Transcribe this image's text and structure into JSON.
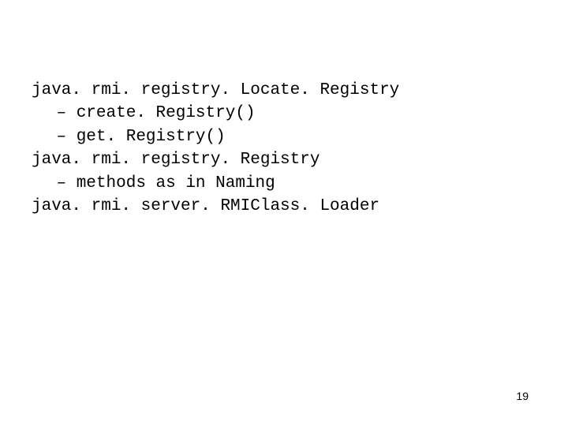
{
  "content": {
    "line1": "java. rmi. registry. Locate. Registry",
    "line2": "– create. Registry()",
    "line3": "– get. Registry()",
    "line4": "java. rmi. registry. Registry",
    "line5": "– methods as in Naming",
    "line6": "java. rmi. server. RMIClass. Loader"
  },
  "pageNumber": "19"
}
